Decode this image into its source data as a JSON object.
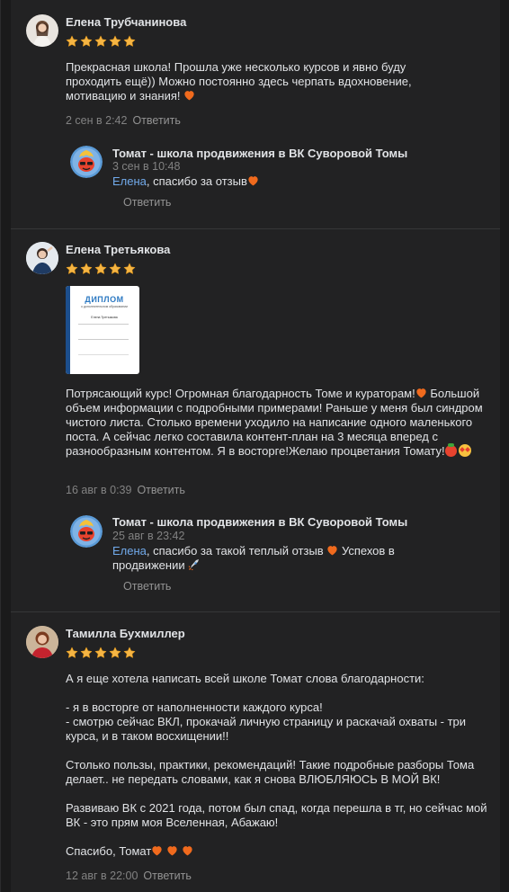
{
  "colors": {
    "background": "#1a1a1b",
    "panel": "#222223",
    "text": "#e1e3e6",
    "muted": "#828282",
    "link": "#71aaeb",
    "star": "#f5b544",
    "heart": "#f06a1d"
  },
  "icons": {
    "star": "star-icon",
    "heart": "orange-heart-icon",
    "tomato": "tomato-icon",
    "smile": "star-struck-emoji-icon",
    "rocket": "rocket-icon"
  },
  "reviews": [
    {
      "author": "Елена Трубчанинова",
      "rating": 5,
      "text": "Прекрасная школа! Прошла уже несколько курсов и явно буду проходить ещё)) Можно постоянно здесь черпать вдохновение, мотивацию и знания!",
      "date": "2 сен в 2:42",
      "reply_label": "Ответить",
      "response": {
        "author": "Томат - школа продвижения в ВК Суворовой Томы",
        "date": "3 сен в 10:48",
        "mention": "Елена",
        "text": ", спасибо за отзыв",
        "reply_label": "Ответить"
      }
    },
    {
      "author": "Елена Третьякова",
      "rating": 5,
      "diploma": {
        "title": "ДИПЛОМ",
        "subtitle": "о дополнительном образовании",
        "name": "Елена Третьякова"
      },
      "text_lines": [
        "Потрясающий курс! Огромная благодарность Томе и кураторам!",
        "Большой объем информации с подробными примерами! Раньше у меня был синдром чистого листа. Столько времени уходило на написание одного маленького поста. А сейчас легко составила контент-план на 3 месяца вперед с разнообразным контентом. Я в восторге!Желаю процветания Томату!"
      ],
      "date": "16 авг в 0:39",
      "reply_label": "Ответить",
      "response": {
        "author": "Томат - школа продвижения в ВК Суворовой Томы",
        "date": "25 авг в 23:42",
        "mention": "Елена",
        "text": ", спасибо за такой теплый отзыв",
        "text_after": " Успехов в продвижении",
        "reply_label": "Ответить"
      }
    },
    {
      "author": "Тамилла Бухмиллер",
      "rating": 5,
      "paragraphs": [
        "А я еще хотела написать всей школе Томат слова благодарности:",
        "- я в восторге от наполненности каждого курса!\n- смотрю сейчас ВКЛ, прокачай личную страницу и раскачай охваты - три курса, и в таком восхищении!!",
        "Столько пользы, практики, рекомендаций! Такие подробные разборы Тома делает.. не передать словами, как я снова ВЛЮБЛЯЮСЬ В МОЙ ВК!",
        "Развиваю ВК с 2021 года, потом был спад, когда перешла в тг, но сейчас мой ВК - это прям моя Вселенная, Абажаю!",
        "Спасибо, Томат"
      ],
      "date": "12 авг в 22:00",
      "reply_label": "Ответить"
    }
  ]
}
